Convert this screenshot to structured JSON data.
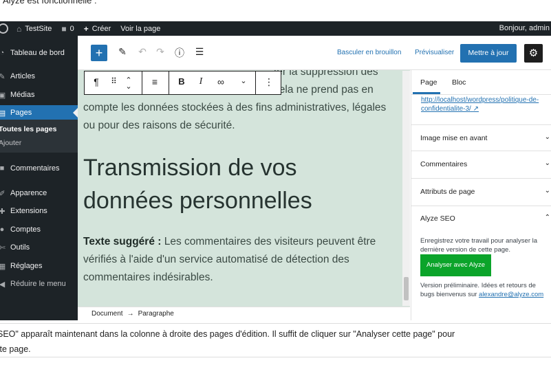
{
  "document": {
    "top_text": "Alyze est fonctionnelle :",
    "caption_line1": "SEO\" apparaît maintenant dans la colonne à droite des pages d'édition. Il suffit de cliquer sur \"Analyser cette page\" pour",
    "caption_line2": "tte page."
  },
  "admin_bar": {
    "site_name": "TestSite",
    "comments_count": "0",
    "new_label": "Créer",
    "view_label": "Voir la page",
    "greeting": "Bonjour, admin"
  },
  "sidebar": {
    "items": [
      {
        "label": "Tableau de bord",
        "icon": "dashboard-icon"
      },
      {
        "label": "Articles",
        "icon": "pin-icon"
      },
      {
        "label": "Médias",
        "icon": "media-icon"
      },
      {
        "label": "Pages",
        "icon": "pages-icon"
      },
      {
        "label": "Commentaires",
        "icon": "comment-icon"
      },
      {
        "label": "Apparence",
        "icon": "brush-icon"
      },
      {
        "label": "Extensions",
        "icon": "plugin-icon"
      },
      {
        "label": "Comptes",
        "icon": "users-icon"
      },
      {
        "label": "Outils",
        "icon": "tools-icon"
      },
      {
        "label": "Réglages",
        "icon": "settings-icon"
      },
      {
        "label": "Réduire le menu",
        "icon": "collapse-icon"
      }
    ],
    "submenu": [
      {
        "label": "Toutes les pages"
      },
      {
        "label": "Ajouter"
      }
    ],
    "active_color": "#2271b1"
  },
  "toolbar": {
    "switch_draft": "Basculer en brouillon",
    "preview": "Prévisualiser",
    "update": "Mettre à jour"
  },
  "editor": {
    "para1_line1": "ter la suppression des",
    "para1_line2": "cela ne prend pas en",
    "para1_line3": "compte les données stockées à des fins administratives, légales",
    "para1_line4": "ou pour des raisons de sécurité.",
    "heading": "Transmission de vos données personnelles",
    "para2_bold": "Texte suggéré :",
    "para2_text": " Les commentaires des visiteurs peuvent être vérifiés à l'aide d'un service automatisé de détection des commentaires indésirables.",
    "canvas_color": "#d4e4db"
  },
  "breadcrumb": {
    "first": "Document",
    "arrow": "→",
    "second": "Paragraphe"
  },
  "settings": {
    "tabs": [
      "Page",
      "Bloc"
    ],
    "permalink": "http://localhost/wordpress/politique-de-confidentialite-3/",
    "panels": [
      {
        "title": "Image mise en avant"
      },
      {
        "title": "Commentaires"
      },
      {
        "title": "Attributs de page"
      },
      {
        "title": "Alyze SEO"
      }
    ],
    "seo_intro": "Enregistrez votre travail pour analyser la dernière version de cette page.",
    "seo_button": "Analyser avec Alyze",
    "seo_note": "Version préliminaire. Idées et retours de bugs bienvenus sur ",
    "seo_email": "alexandre@alyze.com",
    "seo_button_color": "#0ba42a"
  }
}
